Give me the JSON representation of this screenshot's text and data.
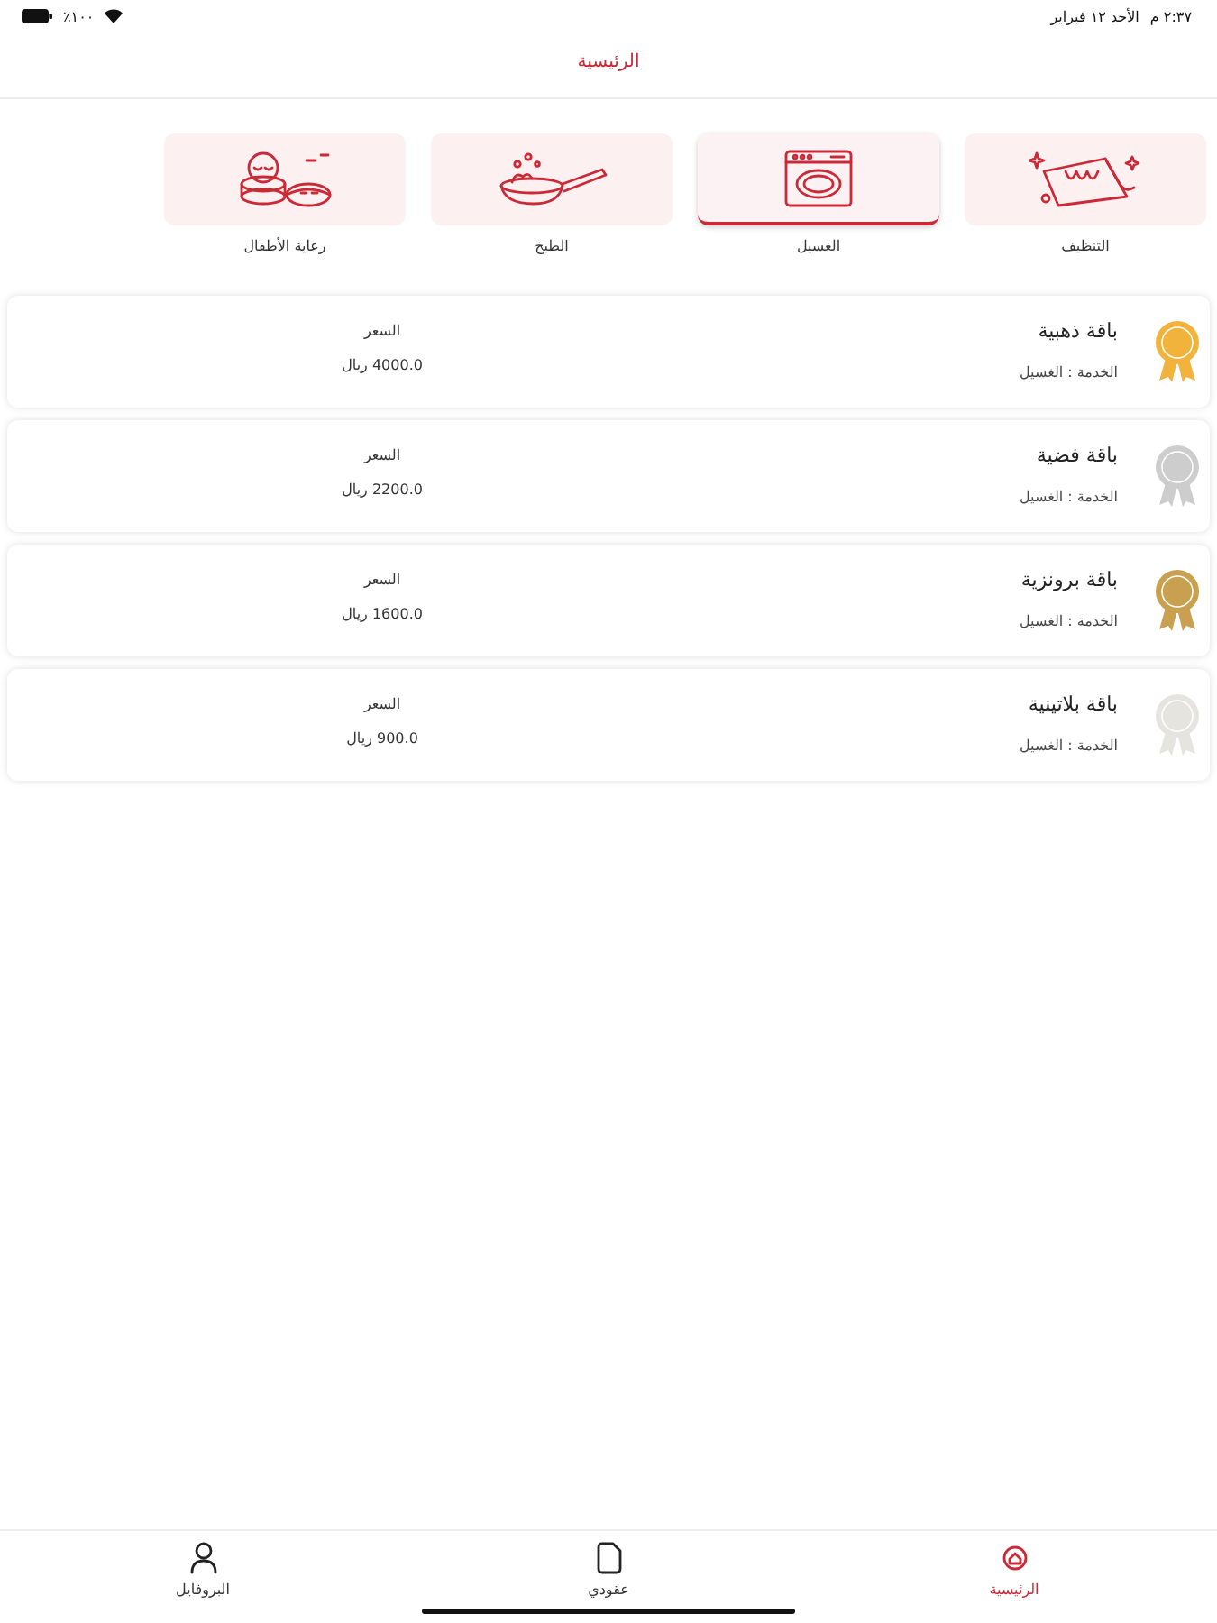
{
  "status_bar": {
    "time": "٢:٣٧ م",
    "date": "الأحد ١٢ فبراير",
    "battery": "١٠٠٪"
  },
  "header": {
    "title": "الرئيسية"
  },
  "categories": [
    {
      "label": "التنظيف",
      "selected": false
    },
    {
      "label": "الغسيل",
      "selected": true
    },
    {
      "label": "الطبخ",
      "selected": false
    },
    {
      "label": "رعاية الأطفال",
      "selected": false
    }
  ],
  "packages": [
    {
      "name": "باقة ذهبية",
      "service": "الخدمة : الغسيل",
      "price_label": "السعر",
      "price": "4000.0 ريال",
      "color": "#f2b33d"
    },
    {
      "name": "باقة فضية",
      "service": "الخدمة : الغسيل",
      "price_label": "السعر",
      "price": "2200.0 ريال",
      "color": "#cdcdcd"
    },
    {
      "name": "باقة برونزية",
      "service": "الخدمة : الغسيل",
      "price_label": "السعر",
      "price": "1600.0 ريال",
      "color": "#c9a050"
    },
    {
      "name": "باقة بلاتينية",
      "service": "الخدمة : الغسيل",
      "price_label": "السعر",
      "price": "900.0 ريال",
      "color": "#e6e4de"
    }
  ],
  "tab_bar": [
    {
      "label": "الرئيسية",
      "selected": true
    },
    {
      "label": "عقودي",
      "selected": false
    },
    {
      "label": "البروفايل",
      "selected": false
    }
  ]
}
